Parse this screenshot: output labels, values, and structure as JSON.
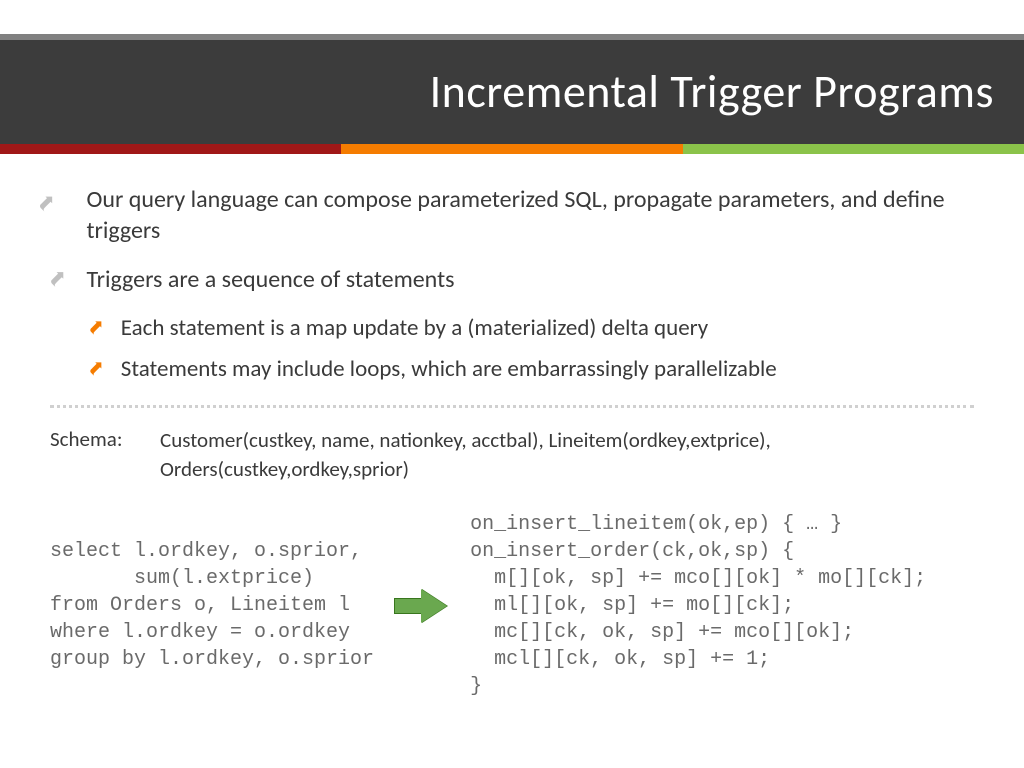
{
  "title": "Incremental Trigger Programs",
  "bullets": {
    "b1": "Our query language can compose parameterized SQL, propagate parameters, and define triggers",
    "b2": "Triggers are a sequence of statements",
    "b2a": "Each statement is a map update by a (materialized) delta query",
    "b2b": "Statements may include loops, which are embarrassingly parallelizable"
  },
  "schema": {
    "label": "Schema:",
    "text": "Customer(custkey, name, nationkey, acctbal), Lineitem(ordkey,extprice), Orders(custkey,ordkey,sprior)"
  },
  "code_left": "select l.ordkey, o.sprior,\n       sum(l.extprice)\nfrom Orders o, Lineitem l\nwhere l.ordkey = o.ordkey\ngroup by l.ordkey, o.sprior",
  "code_right": "on_insert_lineitem(ok,ep) { … }\non_insert_order(ck,ok,sp) {\n  m[][ok, sp] += mco[][ok] * mo[][ck];\n  ml[][ok, sp] += mo[][ck];\n  mc[][ck, ok, sp] += mco[][ok];\n  mcl[][ck, ok, sp] += 1;\n}"
}
